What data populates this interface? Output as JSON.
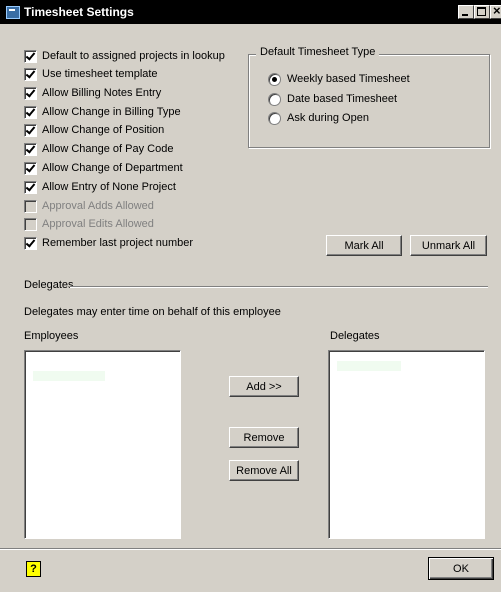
{
  "window": {
    "title": "Timesheet Settings",
    "icons": [
      "app-icon",
      "minimize-icon",
      "maximize-icon",
      "close-icon"
    ]
  },
  "options": [
    {
      "label": "Default to assigned projects in lookup",
      "checked": true,
      "enabled": true
    },
    {
      "label": "Use timesheet template",
      "checked": true,
      "enabled": true
    },
    {
      "label": "Allow Billing Notes Entry",
      "checked": true,
      "enabled": true
    },
    {
      "label": "Allow Change in Billing Type",
      "checked": true,
      "enabled": true
    },
    {
      "label": "Allow Change of Position",
      "checked": true,
      "enabled": true
    },
    {
      "label": "Allow Change of Pay Code",
      "checked": true,
      "enabled": true
    },
    {
      "label": "Allow Change of Department",
      "checked": true,
      "enabled": true
    },
    {
      "label": "Allow Entry of None Project",
      "checked": true,
      "enabled": true
    },
    {
      "label": "Approval Adds Allowed",
      "checked": false,
      "enabled": false
    },
    {
      "label": "Approval Edits Allowed",
      "checked": false,
      "enabled": false
    },
    {
      "label": "Remember last project number",
      "checked": true,
      "enabled": true
    }
  ],
  "timesheet_type": {
    "legend": "Default Timesheet Type",
    "options": [
      {
        "label": "Weekly based Timesheet",
        "selected": true
      },
      {
        "label": "Date based Timesheet",
        "selected": false
      },
      {
        "label": "Ask during Open",
        "selected": false
      }
    ]
  },
  "buttons": {
    "mark_all": "Mark All",
    "unmark_all": "Unmark All",
    "add": "Add >>",
    "remove": "Remove",
    "remove_all": "Remove All",
    "ok": "OK"
  },
  "delegates": {
    "section_label": "Delegates",
    "description": "Delegates may enter time on behalf of this employee",
    "employees_label": "Employees",
    "delegates_label": "Delegates"
  },
  "footer": {
    "help_icon": "help-icon",
    "help_glyph": "?"
  },
  "colors": {
    "titlebar": "#000000",
    "face": "#d4d0c8",
    "list_selection": "#f0fbf0"
  }
}
